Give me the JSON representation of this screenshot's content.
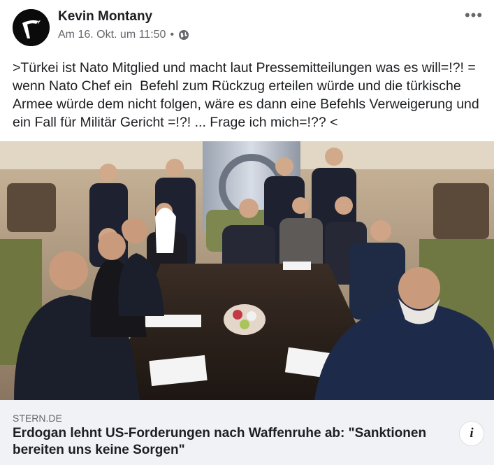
{
  "post": {
    "author": "Kevin Montany",
    "timestamp": "Am 16. Okt. um 11:50",
    "separator": "•",
    "privacy_icon": "globe-icon",
    "more_icon": "more-dots-icon",
    "more_label": "•••",
    "text": ">Türkei ist Nato Mitglied und macht laut Pressemitteilungen was es will=!?! = wenn Nato Chef ein  Befehl zum Rückzug erteilen würde und die türkische Armee würde dem nicht folgen, wäre es dann eine Befehls Verweigerung und ein Fall für Militär Gericht =!?! ... Frage ich mich=!?? <"
  },
  "link": {
    "domain": "STERN.DE",
    "headline": "Erdogan lehnt US-Forderungen nach Waffenruhe ab: \"Sanktionen bereiten uns keine Sorgen\"",
    "info_icon": "info-icon",
    "info_label": "i"
  },
  "colors": {
    "text": "#1c1e21",
    "secondary": "#65676b",
    "preview_bg": "#f0f2f5"
  }
}
